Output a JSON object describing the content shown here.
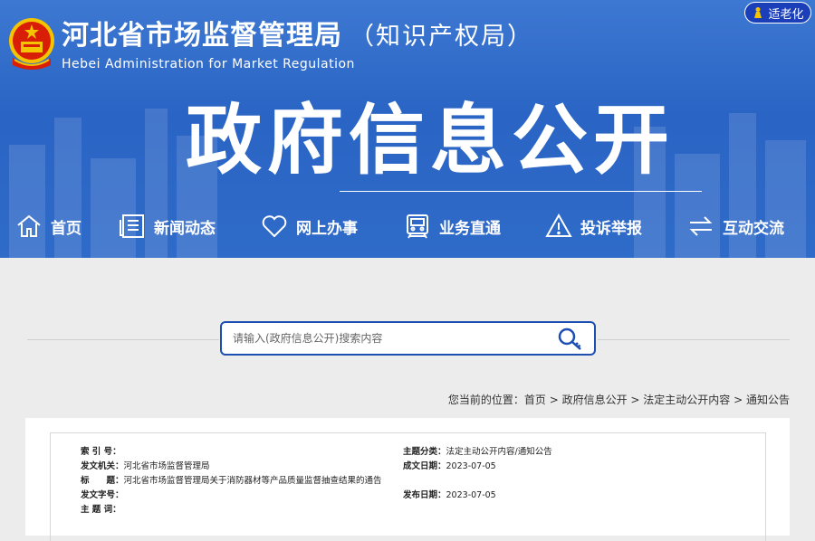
{
  "header": {
    "title_cn": "河北省市场监督管理局",
    "title_sub": "（知识产权局）",
    "title_en": "Hebei Administration for Market Regulation",
    "elder_mode_label": "适老化",
    "banner": "政府信息公开"
  },
  "nav": {
    "items": [
      {
        "label": "首页",
        "icon": "home-icon"
      },
      {
        "label": "新闻动态",
        "icon": "news-icon"
      },
      {
        "label": "网上办事",
        "icon": "heart-icon"
      },
      {
        "label": "业务直通",
        "icon": "train-icon"
      },
      {
        "label": "投诉举报",
        "icon": "warning-icon"
      },
      {
        "label": "互动交流",
        "icon": "exchange-icon"
      }
    ]
  },
  "search": {
    "placeholder": "请输入(政府信息公开)搜索内容"
  },
  "breadcrumb": {
    "prefix": "您当前的位置：",
    "items": [
      "首页",
      "政府信息公开",
      "法定主动公开内容",
      "通知公告"
    ],
    "separator": " > "
  },
  "meta": {
    "index_label": "索 引 号：",
    "index_value": "",
    "issuer_label": "发文机关：",
    "issuer_value": "河北省市场监督管理局",
    "title_label": "标　　题：",
    "title_value": "河北省市场监督管理局关于消防器材等产品质量监督抽查结果的通告",
    "docno_label": "发文字号：",
    "docno_value": "",
    "keyword_label": "主 题 词：",
    "keyword_value": "",
    "category_label": "主题分类：",
    "category_value": "法定主动公开内容/通知公告",
    "created_label": "成文日期：",
    "created_value": "2023-07-05",
    "published_label": "发布日期：",
    "published_value": "2023-07-05"
  },
  "colors": {
    "header_blue": "#2f6bc9",
    "search_border": "#1d4fb3",
    "emblem_red": "#d81e06",
    "emblem_gold": "#f5c400"
  }
}
